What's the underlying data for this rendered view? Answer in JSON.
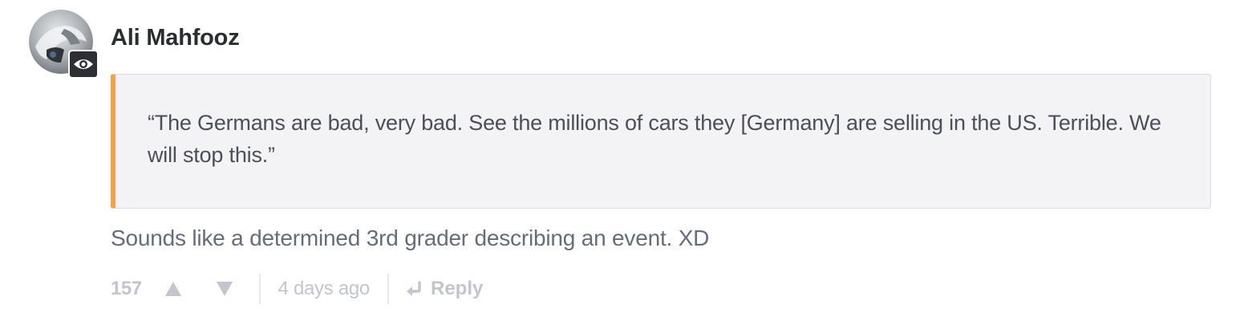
{
  "comment": {
    "author": "Ali Mahfooz",
    "avatar_icon": "user-avatar",
    "badge_icon": "eye-icon",
    "quote": "“The Germans are bad, very bad. See the millions of cars they [Germany] are selling in the US. Terrible. We will stop this.”",
    "text": "Sounds like a determined 3rd grader describing an event. XD",
    "footer": {
      "votes": "157",
      "upvote_icon": "triangle-up-icon",
      "downvote_icon": "triangle-down-icon",
      "timestamp": "4 days ago",
      "reply_icon": "reply-arrow-icon",
      "reply_label": "Reply"
    }
  },
  "colors": {
    "quote_accent": "#f7a04b",
    "quote_background": "#f3f3f5",
    "muted": "#c2c6cc",
    "author": "#2a2e2e"
  }
}
